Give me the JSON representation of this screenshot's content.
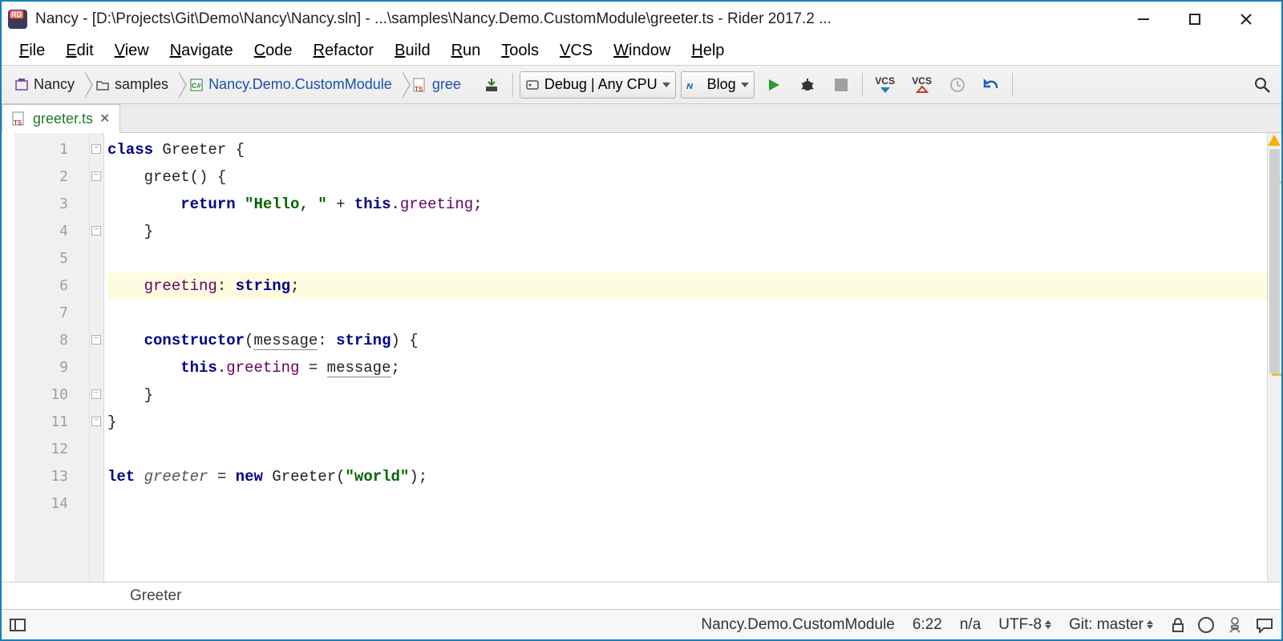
{
  "titlebar": {
    "title": "Nancy - [D:\\Projects\\Git\\Demo\\Nancy\\Nancy.sln] - ...\\samples\\Nancy.Demo.CustomModule\\greeter.ts - Rider 2017.2 ..."
  },
  "menu": {
    "items": [
      "File",
      "Edit",
      "View",
      "Navigate",
      "Code",
      "Refactor",
      "Build",
      "Run",
      "Tools",
      "VCS",
      "Window",
      "Help"
    ]
  },
  "breadcrumbs": {
    "items": [
      {
        "label": "Nancy",
        "icon": "solution",
        "link": false
      },
      {
        "label": "samples",
        "icon": "folder",
        "link": false
      },
      {
        "label": "Nancy.Demo.CustomModule",
        "icon": "csproj",
        "link": true
      },
      {
        "label": "gree",
        "icon": "ts",
        "link": true
      }
    ]
  },
  "toolbar": {
    "config_label": "Debug | Any CPU",
    "run_config_label": "Blog",
    "vcs_update": "VCS",
    "vcs_commit": "VCS"
  },
  "tabs": {
    "active": "greeter.ts"
  },
  "editor": {
    "line_count": 14,
    "highlighted_line": 6,
    "code": [
      [
        {
          "t": "kw",
          "v": "class"
        },
        {
          "t": "sp",
          "v": " "
        },
        {
          "t": "def",
          "v": "Greeter {"
        }
      ],
      [
        {
          "t": "sp",
          "v": "    "
        },
        {
          "t": "def",
          "v": "greet"
        },
        {
          "t": "def",
          "v": "() {"
        }
      ],
      [
        {
          "t": "sp",
          "v": "        "
        },
        {
          "t": "kw",
          "v": "return"
        },
        {
          "t": "sp",
          "v": " "
        },
        {
          "t": "str",
          "v": "\"Hello, \""
        },
        {
          "t": "sp",
          "v": " + "
        },
        {
          "t": "kw2",
          "v": "this"
        },
        {
          "t": "def",
          "v": "."
        },
        {
          "t": "field",
          "v": "greeting"
        },
        {
          "t": "def",
          "v": ";"
        }
      ],
      [
        {
          "t": "sp",
          "v": "    "
        },
        {
          "t": "def",
          "v": "}"
        }
      ],
      [],
      [
        {
          "t": "sp",
          "v": "    "
        },
        {
          "t": "field",
          "v": "greeting"
        },
        {
          "t": "def",
          "v": ": "
        },
        {
          "t": "type",
          "v": "string"
        },
        {
          "t": "def",
          "v": ";"
        }
      ],
      [],
      [
        {
          "t": "sp",
          "v": "    "
        },
        {
          "t": "kw",
          "v": "constructor"
        },
        {
          "t": "def",
          "v": "("
        },
        {
          "t": "ul",
          "v": "message"
        },
        {
          "t": "def",
          "v": ": "
        },
        {
          "t": "type",
          "v": "string"
        },
        {
          "t": "def",
          "v": ") {"
        }
      ],
      [
        {
          "t": "sp",
          "v": "        "
        },
        {
          "t": "kw2",
          "v": "this"
        },
        {
          "t": "def",
          "v": "."
        },
        {
          "t": "field",
          "v": "greeting"
        },
        {
          "t": "def",
          "v": " = "
        },
        {
          "t": "ul",
          "v": "message"
        },
        {
          "t": "def",
          "v": ";"
        }
      ],
      [
        {
          "t": "sp",
          "v": "    "
        },
        {
          "t": "def",
          "v": "}"
        }
      ],
      [
        {
          "t": "def",
          "v": "}"
        }
      ],
      [],
      [
        {
          "t": "kw",
          "v": "let"
        },
        {
          "t": "sp",
          "v": " "
        },
        {
          "t": "it",
          "v": "greeter"
        },
        {
          "t": "sp",
          "v": " = "
        },
        {
          "t": "kw",
          "v": "new"
        },
        {
          "t": "sp",
          "v": " "
        },
        {
          "t": "def",
          "v": "Greeter("
        },
        {
          "t": "str",
          "v": "\"world\""
        },
        {
          "t": "def",
          "v": ");"
        }
      ],
      []
    ],
    "fold_lines": [
      1,
      2,
      4,
      8,
      10,
      11
    ]
  },
  "crumb_footer": "Greeter",
  "statusbar": {
    "project": "Nancy.Demo.CustomModule",
    "position": "6:22",
    "insert": "n/a",
    "encoding": "UTF-8",
    "git": "Git: master"
  }
}
